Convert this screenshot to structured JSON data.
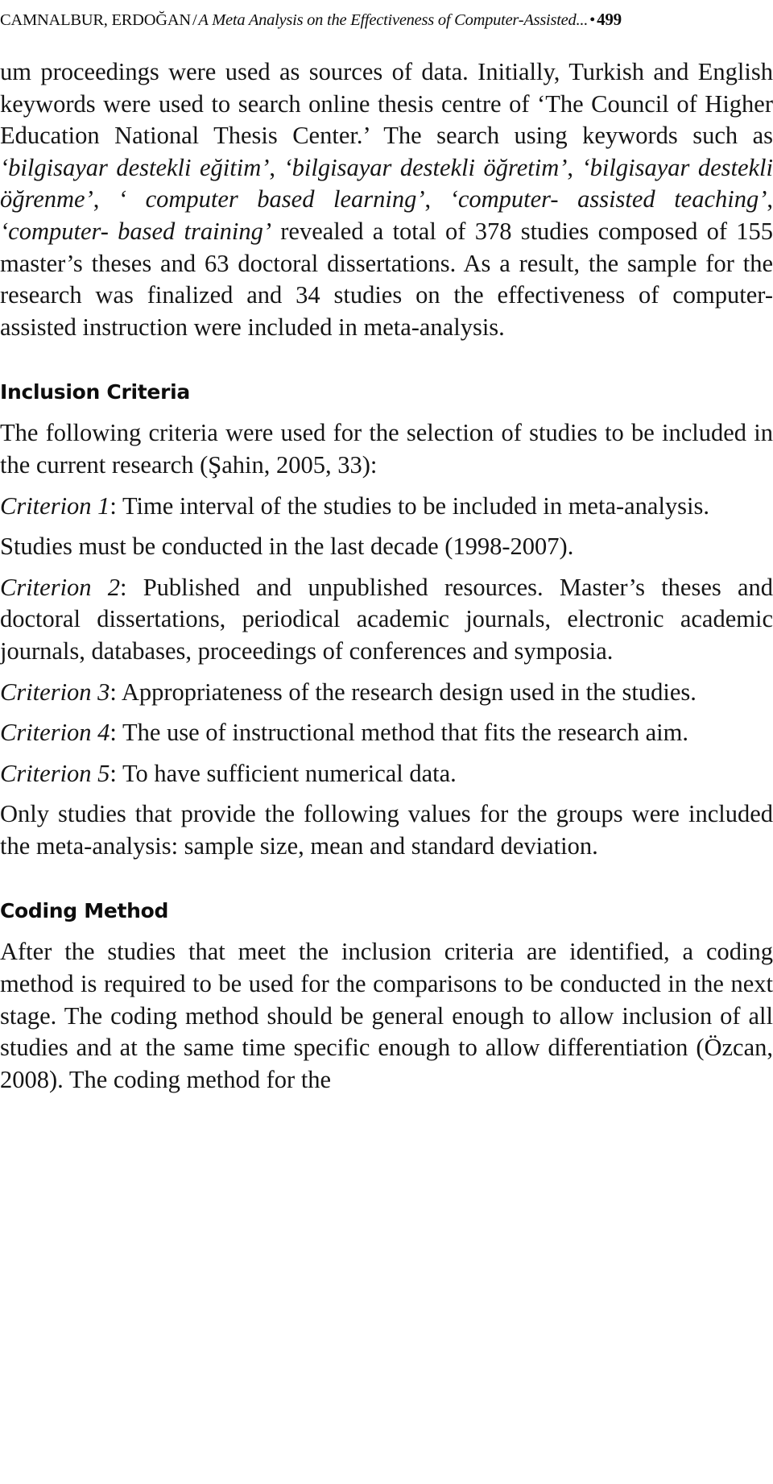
{
  "running_head": {
    "authors": "CAMNALBUR, ERDOĞAN",
    "separator": "/",
    "title": "A Meta Analysis on the Effectiveness of Computer-Assisted...",
    "bullet": "•",
    "page_number": "499"
  },
  "content": {
    "paragraph_continued": {
      "pre_keywords": "um proceedings were used as sources of data. Initially, Turkish and English keywords were used to search online thesis centre of ‘The Council of Higher Education National Thesis Center.’ The search using keywords such as ",
      "keyword_1": "‘bilgisayar destekli eğitim’",
      "sep_1": ", ",
      "keyword_2": "‘bilgisayar destekli öğretim’",
      "sep_2": ", ",
      "keyword_3": "‘bilgisayar destekli öğrenme’",
      "sep_3": ", ",
      "keyword_4": "‘ computer based learning’",
      "sep_4": ", ",
      "keyword_5": "‘computer- assisted teaching’",
      "sep_5": ", ",
      "keyword_6": "‘computer- based training’",
      "post_keywords": " revealed a total of 378 studies composed of 155 master’s theses and 63 doctoral dissertations. As a result, the sample for the research was finalized and 34 studies on the effectiveness of computer- assisted instruction were included in meta-analysis."
    },
    "inclusion_heading": "Inclusion Criteria",
    "inclusion_intro": "The following criteria were used for the selection of studies to be included in the current research (Şahin, 2005, 33):",
    "criteria": [
      {
        "label": "Criterion 1",
        "colon": ": ",
        "text": "Time interval of the studies to be included in meta-analysis."
      },
      {
        "label": "Criterion 2",
        "colon": ": ",
        "text": "Published and unpublished resources. Master’s theses and doctoral dissertations, periodical academic journals, electronic academic journals, databases, proceedings of conferences and symposia."
      },
      {
        "label": "Criterion 3",
        "colon": ": ",
        "text": "Appropriateness of the research design used in the studies."
      },
      {
        "label": "Criterion 4",
        "colon": ": ",
        "text": "The use of instructional method that fits the research aim."
      },
      {
        "label": "Criterion 5",
        "colon": ": ",
        "text": "To have sufficient numerical data."
      }
    ],
    "criterion_1_note": "Studies must be conducted in the last decade (1998-2007).",
    "closing_paragraph": "Only studies that provide the following values for the groups were included the meta-analysis: sample size, mean and standard deviation.",
    "coding_heading": "Coding Method",
    "coding_paragraph": "After the studies that meet the inclusion criteria are identified, a coding method is required to be used for the comparisons to be conducted in the next stage. The coding method should be general enough to allow inclusion of all studies and at the same time specific enough to allow differentiation (Özcan, 2008). The coding method for the"
  }
}
